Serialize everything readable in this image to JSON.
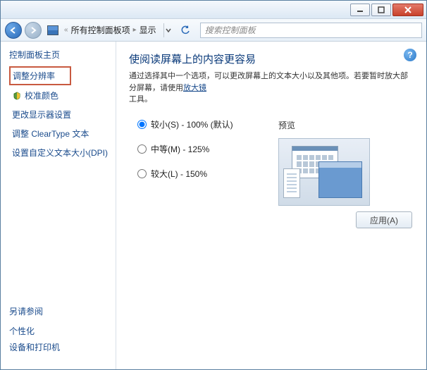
{
  "titlebar": {
    "min": "–",
    "max": "□",
    "close": "×"
  },
  "breadcrumb": {
    "part1": "所有控制面板项",
    "part2": "显示"
  },
  "search": {
    "placeholder": "搜索控制面板"
  },
  "sidebar": {
    "heading": "控制面板主页",
    "items": [
      "调整分辨率",
      "校准颜色",
      "更改显示器设置",
      "调整 ClearType 文本",
      "设置自定义文本大小(DPI)"
    ],
    "seealso_heading": "另请参阅",
    "seealso": [
      "个性化",
      "设备和打印机"
    ]
  },
  "content": {
    "title": "使阅读屏幕上的内容更容易",
    "desc_prefix": "通过选择其中一个选项，可以更改屏幕上的文本大小以及其他项。若要暂时放大部分屏幕，请使用",
    "desc_link": "放大镜",
    "desc_suffix": "工具。",
    "radios": [
      {
        "label": "较小(S) - 100% (默认)",
        "checked": true
      },
      {
        "label": "中等(M) - 125%",
        "checked": false
      },
      {
        "label": "较大(L) - 150%",
        "checked": false
      }
    ],
    "preview_label": "预览",
    "apply_label": "应用(A)"
  }
}
